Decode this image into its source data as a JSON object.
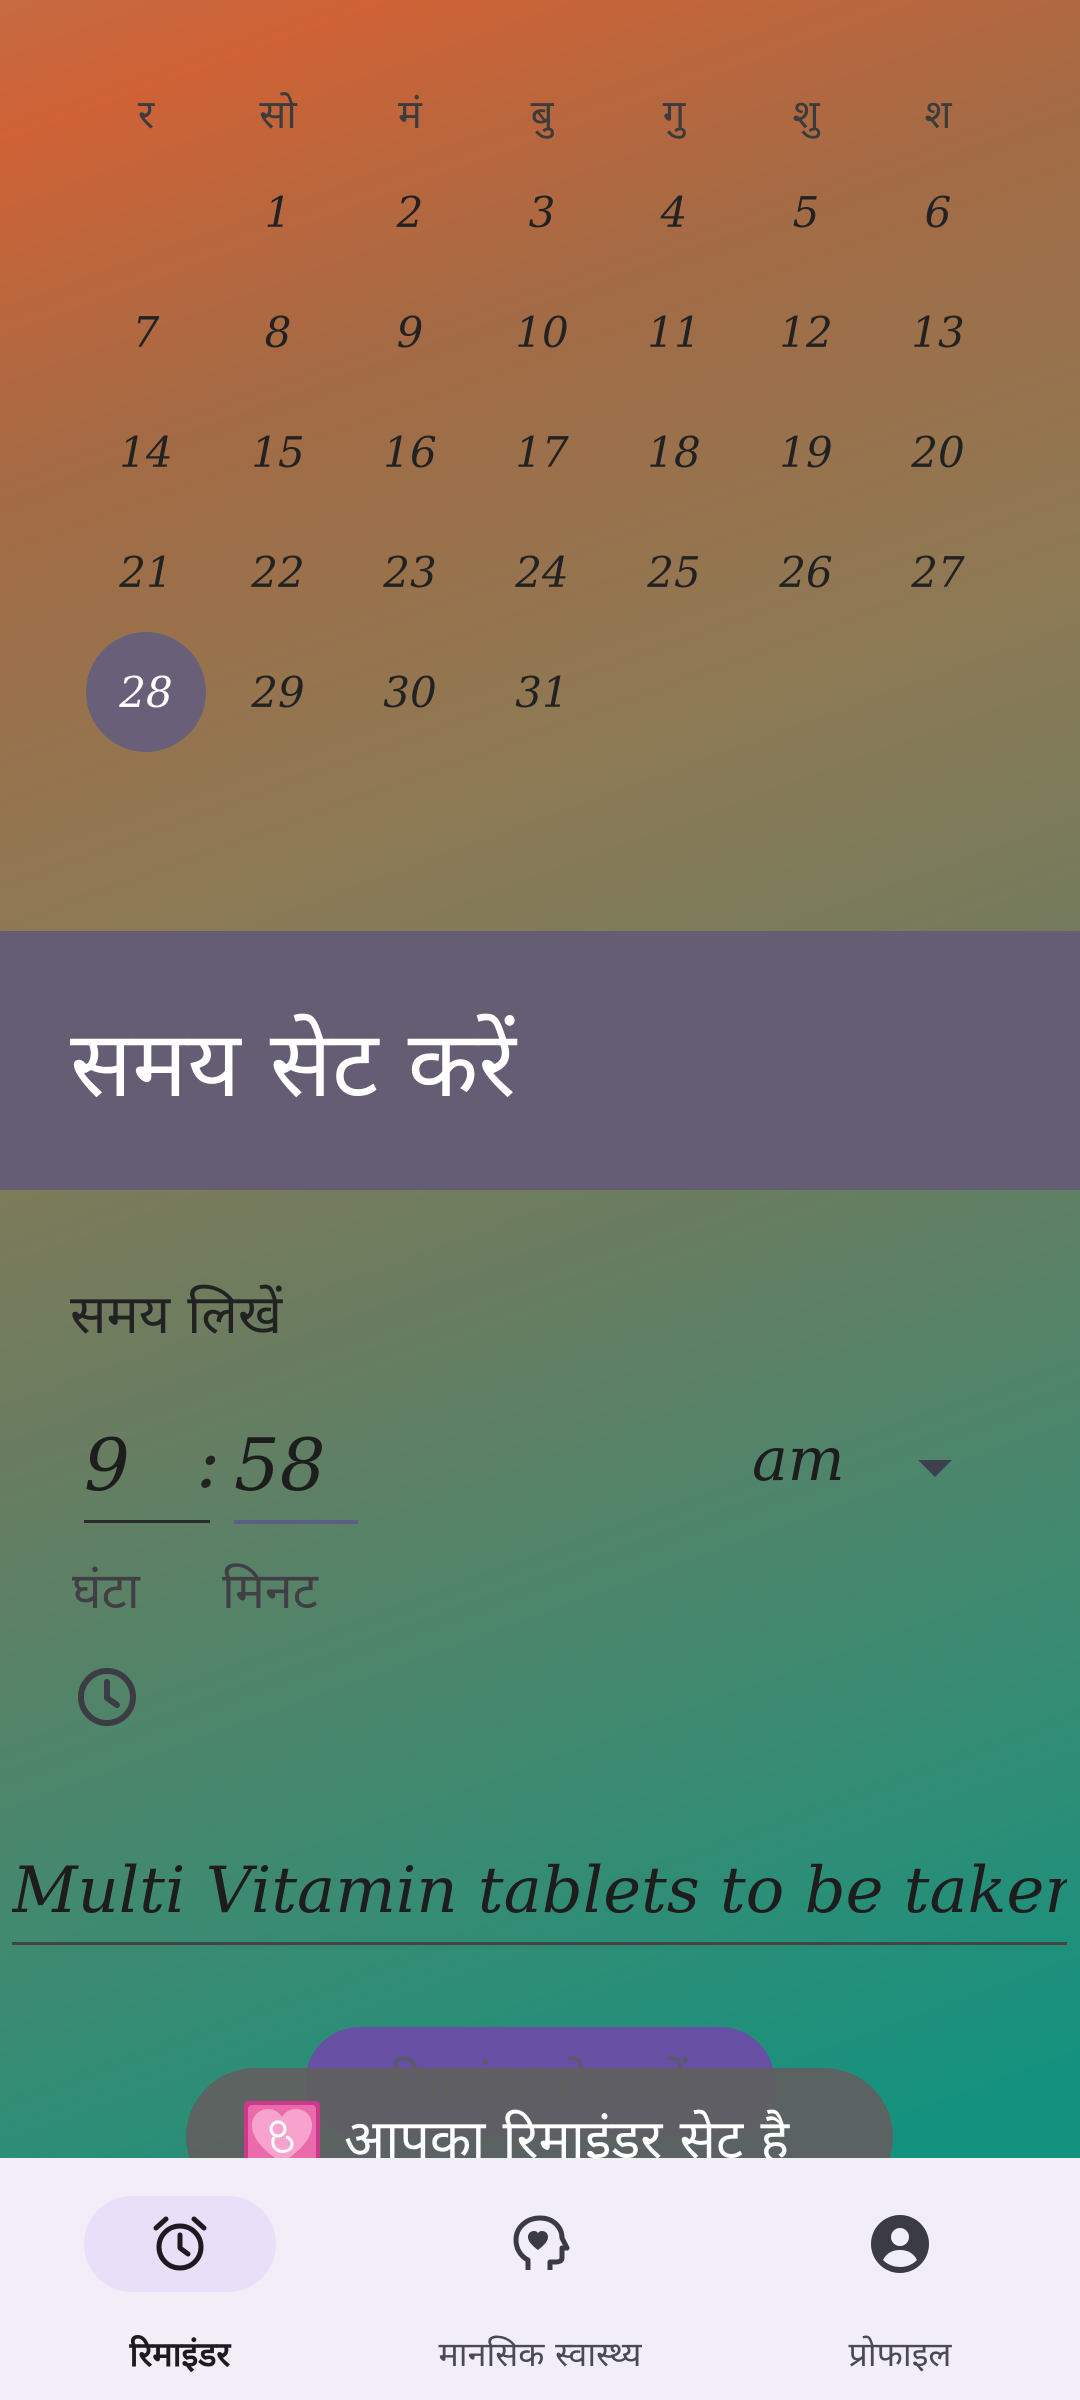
{
  "calendar": {
    "weekdays": [
      "र",
      "सो",
      "मं",
      "बु",
      "गु",
      "शु",
      "श"
    ],
    "days": [
      "",
      "1",
      "2",
      "3",
      "4",
      "5",
      "6",
      "7",
      "8",
      "9",
      "10",
      "11",
      "12",
      "13",
      "14",
      "15",
      "16",
      "17",
      "18",
      "19",
      "20",
      "21",
      "22",
      "23",
      "24",
      "25",
      "26",
      "27",
      "28",
      "29",
      "30",
      "31",
      "",
      "",
      ""
    ],
    "selected_day": "28",
    "selected_color": "#6a5f78"
  },
  "time_section": {
    "title": "समय सेट करें",
    "input_label": "समय लिखें",
    "hour": "9",
    "separator": ":",
    "minute": "58",
    "ampm": "am",
    "hour_label": "घंटा",
    "minute_label": "मिनट",
    "clock_icon": "clock-icon"
  },
  "note": {
    "value": "Multi Vitamin tablets to be taken"
  },
  "actions": {
    "set_reminder_label": "रिमाइंडर सेट करें",
    "accent": "#6750a4"
  },
  "toast": {
    "icon": "pregnancy-heart-icon",
    "message": "आपका रिमाइंडर सेट है"
  },
  "bottom_nav": {
    "items": [
      {
        "label": "रिमाइंडर",
        "icon": "alarm-clock-icon",
        "active": true
      },
      {
        "label": "मानसिक स्वास्थ्य",
        "icon": "mental-health-icon",
        "active": false
      },
      {
        "label": "प्रोफाइल",
        "icon": "profile-icon",
        "active": false
      }
    ]
  }
}
